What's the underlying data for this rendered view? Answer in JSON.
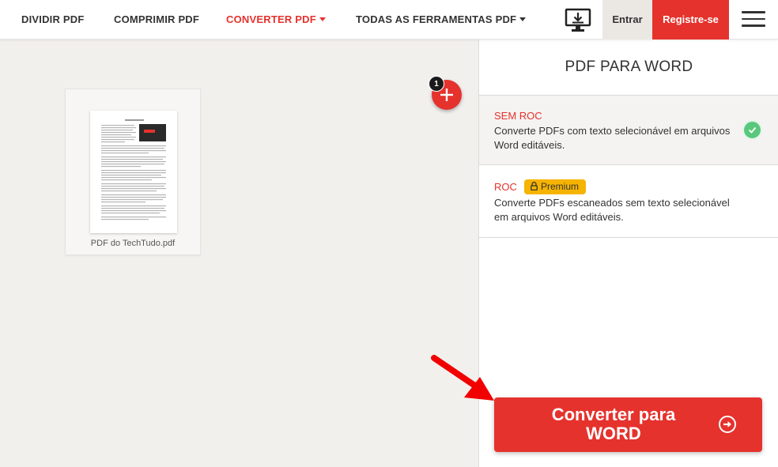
{
  "header": {
    "nav": [
      "DIVIDIR PDF",
      "COMPRIMIR PDF",
      "CONVERTER PDF",
      "TODAS AS FERRAMENTAS PDF"
    ],
    "login_label": "Entrar",
    "register_label": "Registre-se",
    "icons": {
      "desktop": "desktop-download-icon",
      "menu": "hamburger-menu-icon"
    }
  },
  "workspace": {
    "file_name": "PDF do TechTudo.pdf",
    "file_count": "1",
    "add_icon": "plus-icon"
  },
  "sidebar": {
    "title": "PDF PARA WORD",
    "options": [
      {
        "name": "SEM ROC",
        "description": "Converte PDFs com texto selecionável em arquivos Word editáveis.",
        "selected": true
      },
      {
        "name": "ROC",
        "badge": "Premium",
        "description": "Converte PDFs escaneados sem texto selecionável em arquivos Word editáveis.",
        "selected": false
      }
    ],
    "convert_label": "Converter para WORD"
  },
  "colors": {
    "brand": "#e5322d",
    "premium": "#f6b300",
    "check": "#5ac87c",
    "background": "#f2f0ed"
  }
}
